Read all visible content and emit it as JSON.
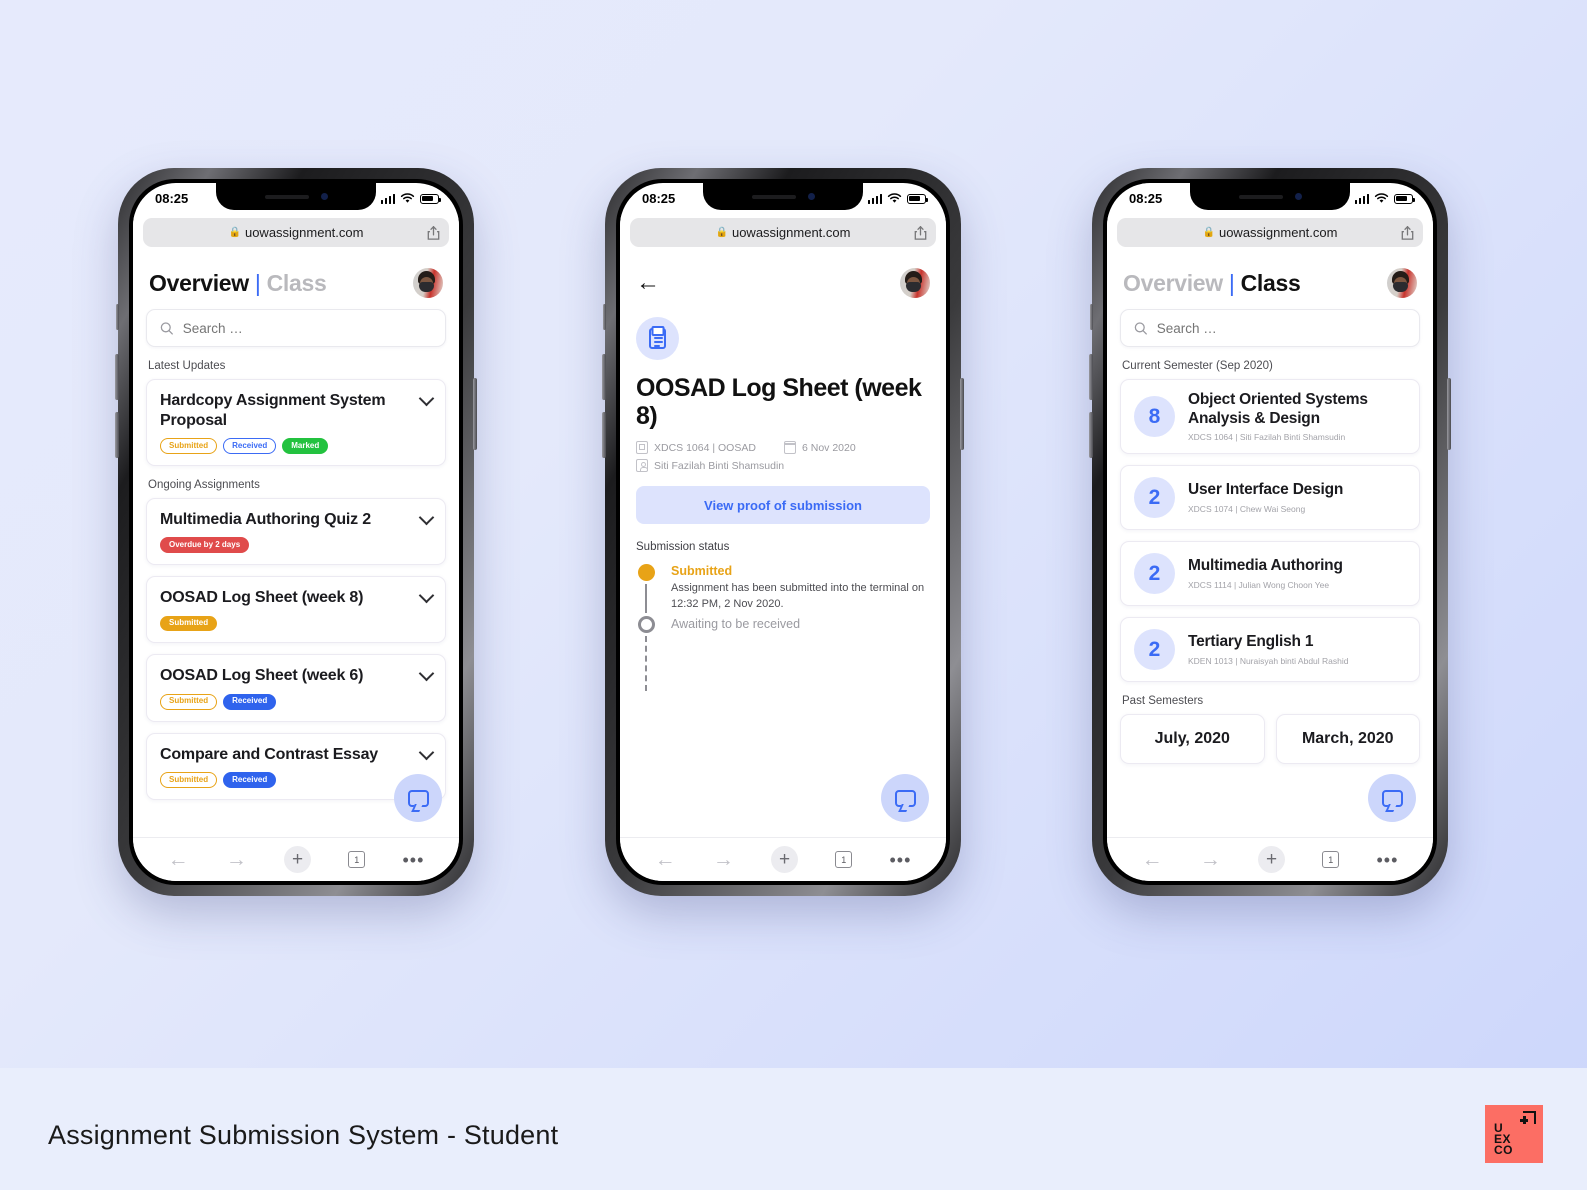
{
  "footer": {
    "caption": "Assignment Submission System - Student",
    "logo_lines": [
      "U",
      "EX",
      "CO"
    ],
    "logo_color": "#fc6e64"
  },
  "theme": {
    "accent": "#3b6bf5",
    "accent_soft": "#dde3fd",
    "orange": "#e8a317",
    "green": "#23c23f",
    "red": "#e04b4b",
    "background_start": "#e6eafc",
    "background_end": "#ccd6fb"
  },
  "status_bar": {
    "time": "08:25"
  },
  "browser": {
    "url": "uowassignment.com",
    "lock_icon": "lock-icon",
    "share_icon": "share-icon",
    "tab_count": "1",
    "back_icon": "arrow-left-icon",
    "forward_icon": "arrow-right-icon",
    "new_tab_icon": "plus-icon",
    "more_icon": "ellipsis-icon"
  },
  "phone1": {
    "tabs": {
      "overview": "Overview",
      "divider": "|",
      "class": "Class",
      "active": "overview"
    },
    "search": {
      "placeholder": "Search …",
      "value": "",
      "icon": "search-icon"
    },
    "sections": [
      {
        "label": "Latest Updates",
        "items": [
          {
            "title": "Hardcopy Assignment System Proposal",
            "badges": [
              {
                "text": "Submitted",
                "style": "b-sub-out"
              },
              {
                "text": "Received",
                "style": "b-rec-out"
              },
              {
                "text": "Marked",
                "style": "b-mark"
              }
            ]
          }
        ]
      },
      {
        "label": "Ongoing Assignments",
        "items": [
          {
            "title": "Multimedia Authoring Quiz 2",
            "badges": [
              {
                "text": "Overdue by 2 days",
                "style": "b-over"
              }
            ]
          },
          {
            "title": "OOSAD Log Sheet (week 8)",
            "badges": [
              {
                "text": "Submitted",
                "style": "b-sub-fill"
              }
            ]
          },
          {
            "title": "OOSAD Log Sheet (week 6)",
            "badges": [
              {
                "text": "Submitted",
                "style": "b-sub-out"
              },
              {
                "text": "Received",
                "style": "b-rec-fill"
              }
            ]
          },
          {
            "title": "Compare and Contrast Essay",
            "badges": [
              {
                "text": "Submitted",
                "style": "b-sub-out"
              },
              {
                "text": "Received",
                "style": "b-rec-fill"
              }
            ]
          }
        ]
      }
    ],
    "chat_fab": "chat-bubble-icon"
  },
  "phone2": {
    "back_icon": "arrow-left-icon",
    "doc_icon": "clipboard-icon",
    "title": "OOSAD Log Sheet (week 8)",
    "meta": {
      "course": "XDCS 1064 | OOSAD",
      "due_date": "6 Nov 2020",
      "lecturer": "Siti Fazilah Binti Shamsudin",
      "course_icon": "document-icon",
      "date_icon": "calendar-icon",
      "lecturer_icon": "id-card-icon"
    },
    "proof_button": "View proof of submission",
    "status_label": "Submission status",
    "timeline": [
      {
        "state": "done",
        "heading": "Submitted",
        "body": "Assignment has been submitted into the terminal on 12:32 PM, 2 Nov 2020."
      },
      {
        "state": "pending",
        "heading": "Awaiting to be received",
        "body": ""
      }
    ],
    "chat_fab": "chat-bubble-icon"
  },
  "phone3": {
    "tabs": {
      "overview": "Overview",
      "divider": "|",
      "class": "Class",
      "active": "class"
    },
    "search": {
      "placeholder": "Search …",
      "value": "",
      "icon": "search-icon"
    },
    "current_label": "Current Semester (Sep 2020)",
    "classes": [
      {
        "count": "8",
        "name": "Object Oriented Systems Analysis & Design",
        "sub": "XDCS 1064 | Siti Fazilah Binti Shamsudin"
      },
      {
        "count": "2",
        "name": "User Interface Design",
        "sub": "XDCS 1074 | Chew Wai Seong"
      },
      {
        "count": "2",
        "name": "Multimedia Authoring",
        "sub": "XDCS 1114 | Julian Wong Choon Yee"
      },
      {
        "count": "2",
        "name": "Tertiary English 1",
        "sub": "KDEN 1013 | Nuraisyah binti Abdul Rashid"
      }
    ],
    "past_label": "Past Semesters",
    "past_semesters": [
      {
        "name": "July, 2020"
      },
      {
        "name": "March, 2020"
      }
    ],
    "chat_fab": "chat-bubble-icon"
  }
}
